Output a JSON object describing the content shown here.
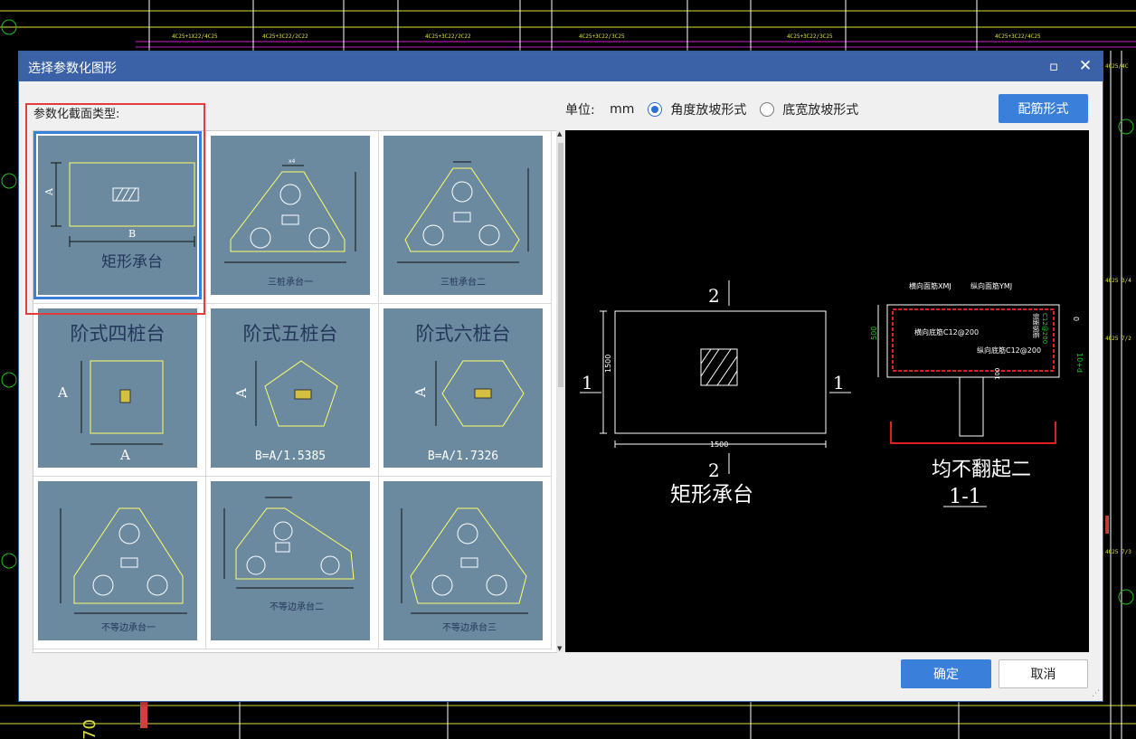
{
  "dialog": {
    "title": "选择参数化图形",
    "section_label": "参数化截面类型:",
    "unit_label": "单位:",
    "unit_value": "mm",
    "radio_options": [
      {
        "label": "角度放坡形式",
        "checked": true
      },
      {
        "label": "底宽放坡形式",
        "checked": false
      }
    ],
    "rebar_button": "配筋形式",
    "ok_button": "确定",
    "cancel_button": "取消"
  },
  "shapes": [
    {
      "name": "矩形承台",
      "selected": true
    },
    {
      "name": "三桩承台一"
    },
    {
      "name": "三桩承台二"
    },
    {
      "name": "阶式四桩台"
    },
    {
      "name": "阶式五桩台",
      "formula": "B=A/1.5385"
    },
    {
      "name": "阶式六桩台",
      "formula": "B=A/1.7326"
    },
    {
      "name": "不等边承台一"
    },
    {
      "name": "不等边承台二"
    },
    {
      "name": "不等边承台三"
    }
  ],
  "preview": {
    "plan_caption": "矩形承台",
    "section_caption": "均不翻起二",
    "section_id": "1-1",
    "dim_width": "1500",
    "dim_height": "1500",
    "dim_depth": "500",
    "cut_mark_1": "1",
    "cut_mark_2": "2",
    "rebar_labels": {
      "top_x": "横向面筋XMJ",
      "top_y": "纵向面筋YMJ",
      "bot_x": "横向底筋C12@200",
      "bot_y": "纵向底筋C12@200",
      "side": "侧面钢筋",
      "side_val": "C12@200",
      "cover_top": "0",
      "cover_bot": "10+d",
      "cover_side": "100"
    }
  },
  "colors": {
    "accent": "#3a7fd9",
    "titlebar": "#3b62a6",
    "thumb_bg": "#6b8aa0",
    "highlight": "#e23c3c"
  }
}
